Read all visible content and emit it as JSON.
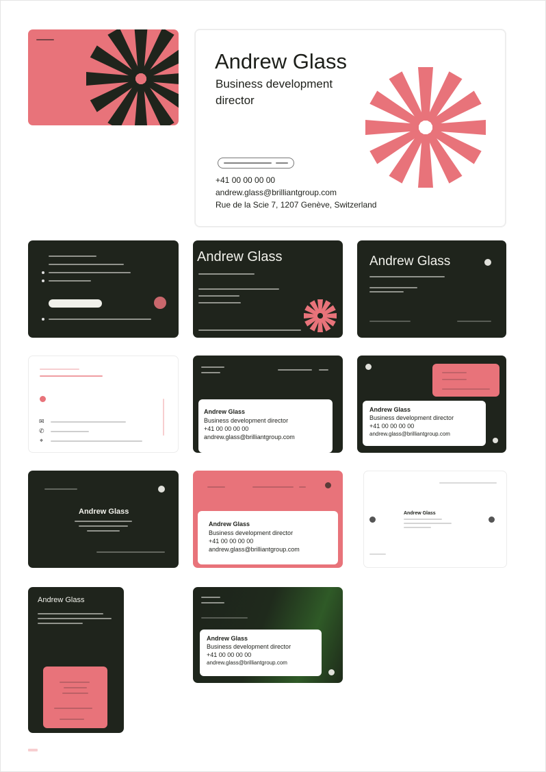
{
  "colors": {
    "dark": "#1f241c",
    "pink": "#e8737a",
    "white": "#ffffff",
    "text": "#1d1f1a"
  },
  "hero": {
    "name": "Andrew Glass",
    "title_line1": "Business development",
    "title_line2": "director",
    "phone": "+41 00 00 00 00",
    "email": "andrew.glass@brilliantgroup.com",
    "address": "Rue de la Scie 7, 1207 Genève, Switzerland"
  },
  "cards": {
    "dark_name_1": "Andrew Glass",
    "dark_name_2": "Andrew Glass",
    "tab_card_1": {
      "name": "Andrew Glass",
      "title": "Business development director",
      "phone": "+41 00 00 00 00",
      "email": "andrew.glass@brilliantgroup.com"
    },
    "tab_card_2": {
      "name": "Andrew Glass",
      "title": "Business development director",
      "phone": "+41 00 00 00 00",
      "email": "andrew.glass@brilliantgroup.com"
    },
    "dark_center_name": "Andrew Glass",
    "pink_tab_card": {
      "name": "Andrew Glass",
      "title": "Business development director",
      "phone": "+41 00 00 00 00",
      "email": "andrew.glass@brilliantgroup.com"
    },
    "light_center_name": "Andrew Glass",
    "vertical_name": "Andrew Glass",
    "gradient_card": {
      "name": "Andrew Glass",
      "title": "Business development director",
      "phone": "+41 00 00 00 00",
      "email": "andrew.glass@brilliantgroup.com"
    }
  }
}
